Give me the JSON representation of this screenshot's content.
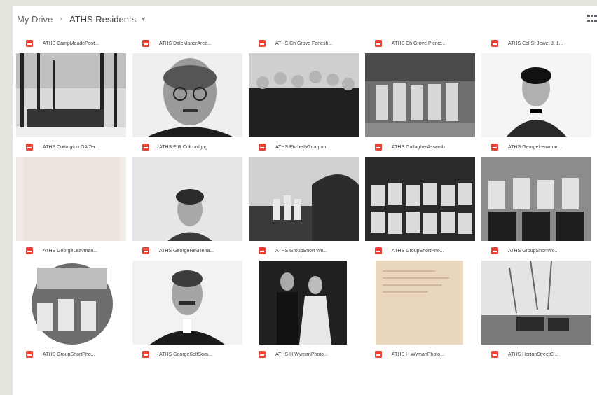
{
  "breadcrumb": {
    "root": "My Drive",
    "current": "ATHS Residents"
  },
  "files": [
    {
      "name": "ATHS CampMeadePost...",
      "thumb": "none"
    },
    {
      "name": "ATHS DaleManorArea...",
      "thumb": "none"
    },
    {
      "name": "ATHS Ch Grove Fonesh...",
      "thumb": "none"
    },
    {
      "name": "ATHS Ch Grove Picnic...",
      "thumb": "none"
    },
    {
      "name": "ATHS Col St Jewet J. 1...",
      "thumb": "none"
    },
    {
      "name": "ATHS Cottington GA Ter...",
      "thumb": "snow-trees"
    },
    {
      "name": "ATHS E R Colcord.jpg",
      "thumb": "bald-man-glasses"
    },
    {
      "name": "ATHS ElizbethGroupon...",
      "thumb": "group-of-women"
    },
    {
      "name": "ATHS GallagherAssemb...",
      "thumb": "girls-on-porch"
    },
    {
      "name": "ATHS GeorgeLeavman...",
      "thumb": "young-man-bowtie"
    },
    {
      "name": "ATHS GeorgeLeavman...",
      "thumb": "blank-paper"
    },
    {
      "name": "ATHS GeorgeRevillena...",
      "thumb": "young-man-portrait"
    },
    {
      "name": "ATHS GroupShort Wil...",
      "thumb": "outdoor-group"
    },
    {
      "name": "ATHS GroupShortPho...",
      "thumb": "class-photo"
    },
    {
      "name": "ATHS GroupShortWo...",
      "thumb": "seated-group"
    },
    {
      "name": "ATHS GroupShortPho...",
      "thumb": "circle-group"
    },
    {
      "name": "ATHS GeorgeSelfSom...",
      "thumb": "mustache-man"
    },
    {
      "name": "ATHS H WymanPhoto...",
      "thumb": "couple"
    },
    {
      "name": "ATHS H WymanPhoto...",
      "thumb": "letter"
    },
    {
      "name": "ATHS HortonStreetCl...",
      "thumb": "horse-wagon"
    }
  ],
  "colors": {
    "pdf_icon": "#ea4335",
    "background": "#e4e3dc"
  }
}
